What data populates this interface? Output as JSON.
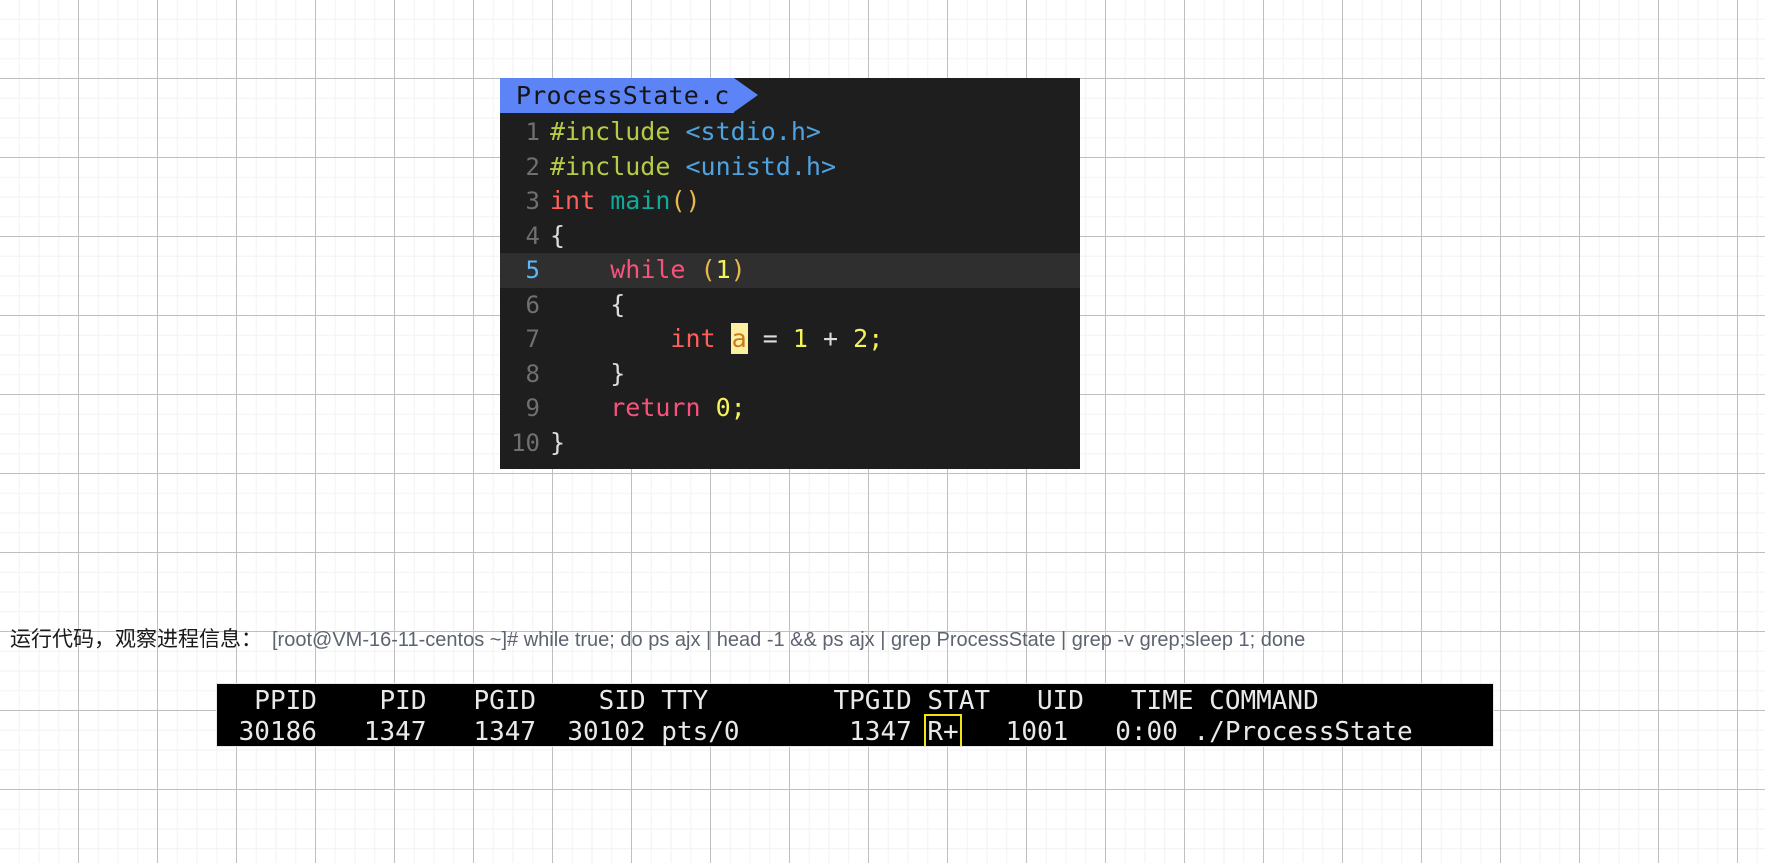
{
  "code_card": {
    "tab_label": "ProcessState.c",
    "active_line": 5,
    "lines": [
      {
        "n": "1",
        "text": "#include <stdio.h>"
      },
      {
        "n": "2",
        "text": "#include <unistd.h>"
      },
      {
        "n": "3",
        "text": "int main()"
      },
      {
        "n": "4",
        "text": "{"
      },
      {
        "n": "5",
        "text": "    while (1)"
      },
      {
        "n": "6",
        "text": "    {"
      },
      {
        "n": "7",
        "text": "        int a = 1 + 2;"
      },
      {
        "n": "8",
        "text": "    }"
      },
      {
        "n": "9",
        "text": "    return 0;"
      },
      {
        "n": "10",
        "text": "}"
      }
    ],
    "tokens": {
      "include": "#include",
      "hdr_stdio": "<stdio.h>",
      "hdr_unistd": "<unistd.h>",
      "int": "int",
      "main": "main",
      "parens_empty": "()",
      "brace_open": "{",
      "brace_close": "}",
      "while": "while",
      "paren_l": "(",
      "paren_r": ")",
      "one": "1",
      "two": "2",
      "zero": "0",
      "var_a": "a",
      "equals": "=",
      "plus": "+",
      "semi": ";",
      "return": "return"
    },
    "colors": {
      "background": "#1e1e1e",
      "active_line_bg": "#2f2f2f",
      "tab_bg": "#5c84f7",
      "gutter_text": "#707070",
      "active_gutter_text": "#5ab7f8",
      "preprocessor": "#b5cc46",
      "header": "#4ea3e0",
      "type": "#ff5f5a",
      "function": "#0fab9a",
      "keyword": "#f8527c",
      "number": "#f5f35a",
      "paren": "#e8b84b",
      "punct": "#dcdcdc",
      "highlight_bg": "#fbf0a2",
      "highlight_text": "#c87b1a"
    }
  },
  "caption": {
    "zh_label": "运行代码，观察进程信息：",
    "command": "[root@VM-16-11-centos ~]# while true; do ps ajx | head -1 && ps ajx | grep ProcessState | grep -v grep;sleep 1; done"
  },
  "terminal": {
    "columns": [
      "PPID",
      "PID",
      "PGID",
      "SID",
      "TTY",
      "TPGID",
      "STAT",
      "UID",
      "TIME",
      "COMMAND"
    ],
    "header_line": "  PPID    PID   PGID    SID TTY        TPGID STAT   UID   TIME COMMAND",
    "row_prefix": " 30186   1347   1347  30102 pts/0       1347 ",
    "row_stat": "R+",
    "row_suffix": "   1001   0:00 ./ProcessState",
    "row": {
      "PPID": "30186",
      "PID": "1347",
      "PGID": "1347",
      "SID": "30102",
      "TTY": "pts/0",
      "TPGID": "1347",
      "STAT": "R+",
      "UID": "1001",
      "TIME": "0:00",
      "COMMAND": "./ProcessState"
    },
    "colors": {
      "background": "#000000",
      "text": "#e9e9e9",
      "highlight_outline": "#f2e414"
    }
  }
}
